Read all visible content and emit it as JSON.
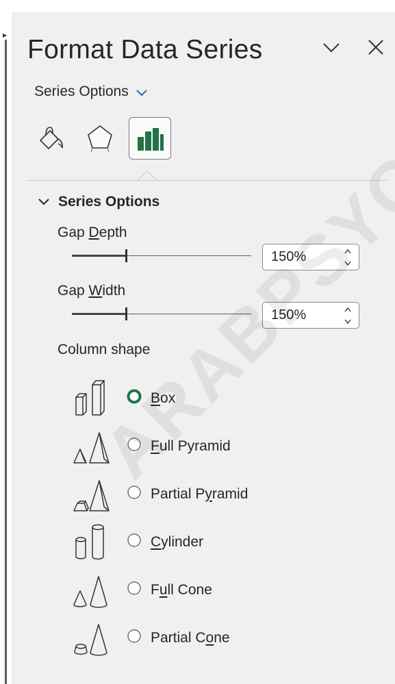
{
  "pane": {
    "title": "Format Data Series",
    "series_dropdown": "Series Options"
  },
  "tabs": [
    {
      "name": "Fill & Line",
      "icon": "paint-bucket-icon",
      "active": false
    },
    {
      "name": "Effects",
      "icon": "pentagon-icon",
      "active": false
    },
    {
      "name": "Series Options",
      "icon": "bar-chart-icon",
      "active": true
    }
  ],
  "section": {
    "title": "Series Options",
    "gap_depth": {
      "label_pre": "Gap ",
      "label_key": "D",
      "label_post": "epth",
      "value": "150%",
      "slider_fraction": 0.3
    },
    "gap_width": {
      "label_pre": "Gap ",
      "label_key": "W",
      "label_post": "idth",
      "value": "150%",
      "slider_fraction": 0.3
    },
    "column_shape_label": "Column shape",
    "shapes": [
      {
        "pre": "",
        "key": "B",
        "post": "ox",
        "selected": true,
        "icon": "box-shape-icon"
      },
      {
        "pre": "",
        "key": "F",
        "post": "ull Pyramid",
        "selected": false,
        "icon": "full-pyramid-icon"
      },
      {
        "pre": "Partial P",
        "key": "y",
        "post": "ramid",
        "selected": false,
        "icon": "partial-pyramid-icon"
      },
      {
        "pre": "",
        "key": "C",
        "post": "ylinder",
        "selected": false,
        "icon": "cylinder-icon"
      },
      {
        "pre": "F",
        "key": "u",
        "post": "ll Cone",
        "selected": false,
        "icon": "full-cone-icon"
      },
      {
        "pre": "Partial C",
        "key": "o",
        "post": "ne",
        "selected": false,
        "icon": "partial-cone-icon"
      }
    ]
  },
  "watermark": "ARABPSYCH",
  "colors": {
    "accent": "#217346",
    "dropdown_chevron": "#1e6fc2",
    "panel_bg": "#f0f0f0"
  }
}
